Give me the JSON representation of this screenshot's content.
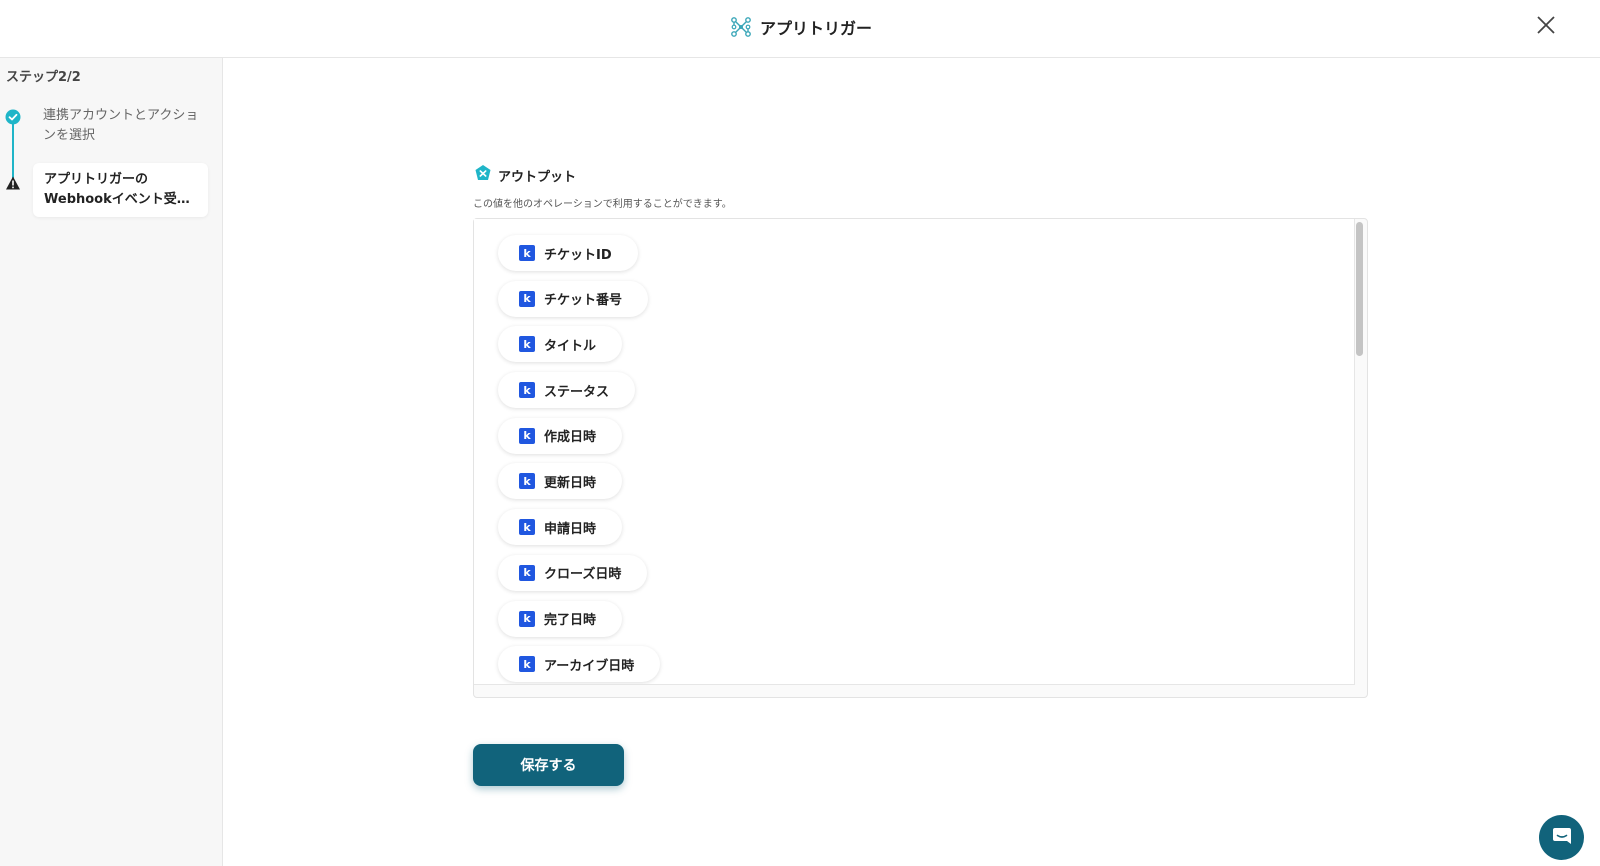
{
  "header": {
    "title": "アプリトリガー",
    "logo_icon": "app-trigger-network-icon",
    "close_icon": "close-icon"
  },
  "sidebar": {
    "step_label": "ステップ2/2",
    "steps": [
      {
        "label": "連携アカウントとアクションを選択",
        "status": "done",
        "icon": "check-circle-icon"
      },
      {
        "label_line1": "アプリトリガーの",
        "label_line2": "Webhookイベント受…",
        "status": "warning",
        "icon": "warning-triangle-icon"
      }
    ]
  },
  "output": {
    "title": "アウトプット",
    "description": "この値を他のオペレーションで利用することができます。",
    "icon": "output-badge-icon",
    "items": [
      "チケットID",
      "チケット番号",
      "タイトル",
      "ステータス",
      "作成日時",
      "更新日時",
      "申請日時",
      "クローズ日時",
      "完了日時",
      "アーカイブ日時"
    ],
    "item_icon_letter": "k"
  },
  "save_button": {
    "label": "保存する"
  },
  "colors": {
    "accent": "#11637b",
    "step_line": "#1fb5c8",
    "item_icon_bg": "#2057e0"
  },
  "chat_icon": "chat-bubble-icon"
}
